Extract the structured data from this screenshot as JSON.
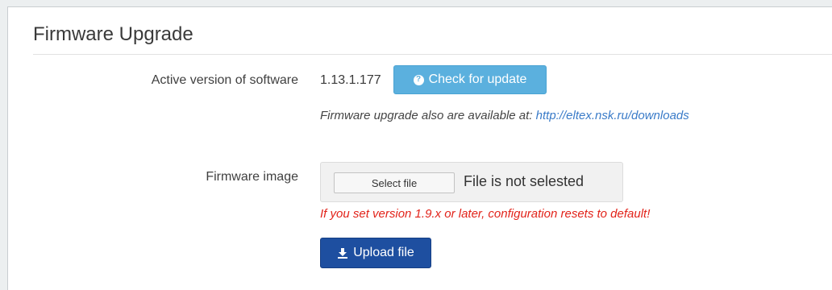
{
  "panel": {
    "title": "Firmware Upgrade"
  },
  "software": {
    "label": "Active version of software",
    "version": "1.13.1.177",
    "check_button_label": "Check for update",
    "check_button_icon": "question-circle-icon",
    "hint_text": "Firmware upgrade also are available at:",
    "hint_link": "http://eltex.nsk.ru/downloads"
  },
  "image": {
    "label": "Firmware image",
    "select_button_label": "Select file",
    "file_status": "File is not selested",
    "warning": "If you set version 1.9.x or later, configuration resets to default!",
    "upload_button_label": "Upload file",
    "upload_button_icon": "download-icon"
  },
  "colors": {
    "check_button": "#5bb0de",
    "upload_button": "#1e4fa0",
    "link": "#3a7bc8",
    "warning": "#e2231a"
  }
}
